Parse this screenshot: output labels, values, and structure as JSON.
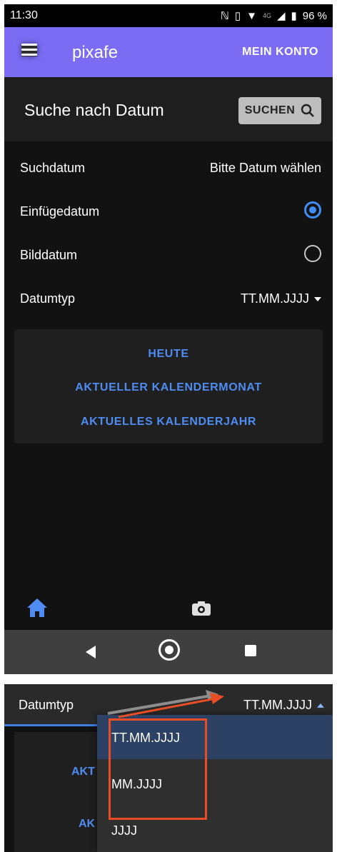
{
  "status": {
    "time": "11:30",
    "battery": "96 %",
    "network": "4G",
    "icons": [
      "nfc-icon",
      "vibrate-icon",
      "wifi-icon",
      "signal-icon",
      "battery-icon"
    ]
  },
  "appbar": {
    "title": "pixafe",
    "account": "MEIN KONTO",
    "bg": "#7c6cf4"
  },
  "header": {
    "title": "Suche nach Datum",
    "search_label": "SUCHEN"
  },
  "rows": {
    "search_date_label": "Suchdatum",
    "search_date_value": "Bitte Datum wählen",
    "insert_date_label": "Einfügedatum",
    "image_date_label": "Bilddatum",
    "date_type_label": "Datumtyp",
    "date_type_value": "TT.MM.JJJJ"
  },
  "card": {
    "today": "HEUTE",
    "month": "AKTUELLER KALENDERMONAT",
    "year": "AKTUELLES KALENDERJAHR"
  },
  "bottom_nav": {
    "icons": [
      "home-icon",
      "camera-icon"
    ]
  },
  "zoom": {
    "date_type_label": "Datumtyp",
    "date_type_value": "TT.MM.JJJJ",
    "partial_1": "AKT",
    "partial_2": "AK",
    "options": [
      "TT.MM.JJJJ",
      "MM.JJJJ",
      "JJJJ"
    ]
  },
  "colors": {
    "accent": "#3f8df7",
    "highlight": "#e84d26"
  }
}
